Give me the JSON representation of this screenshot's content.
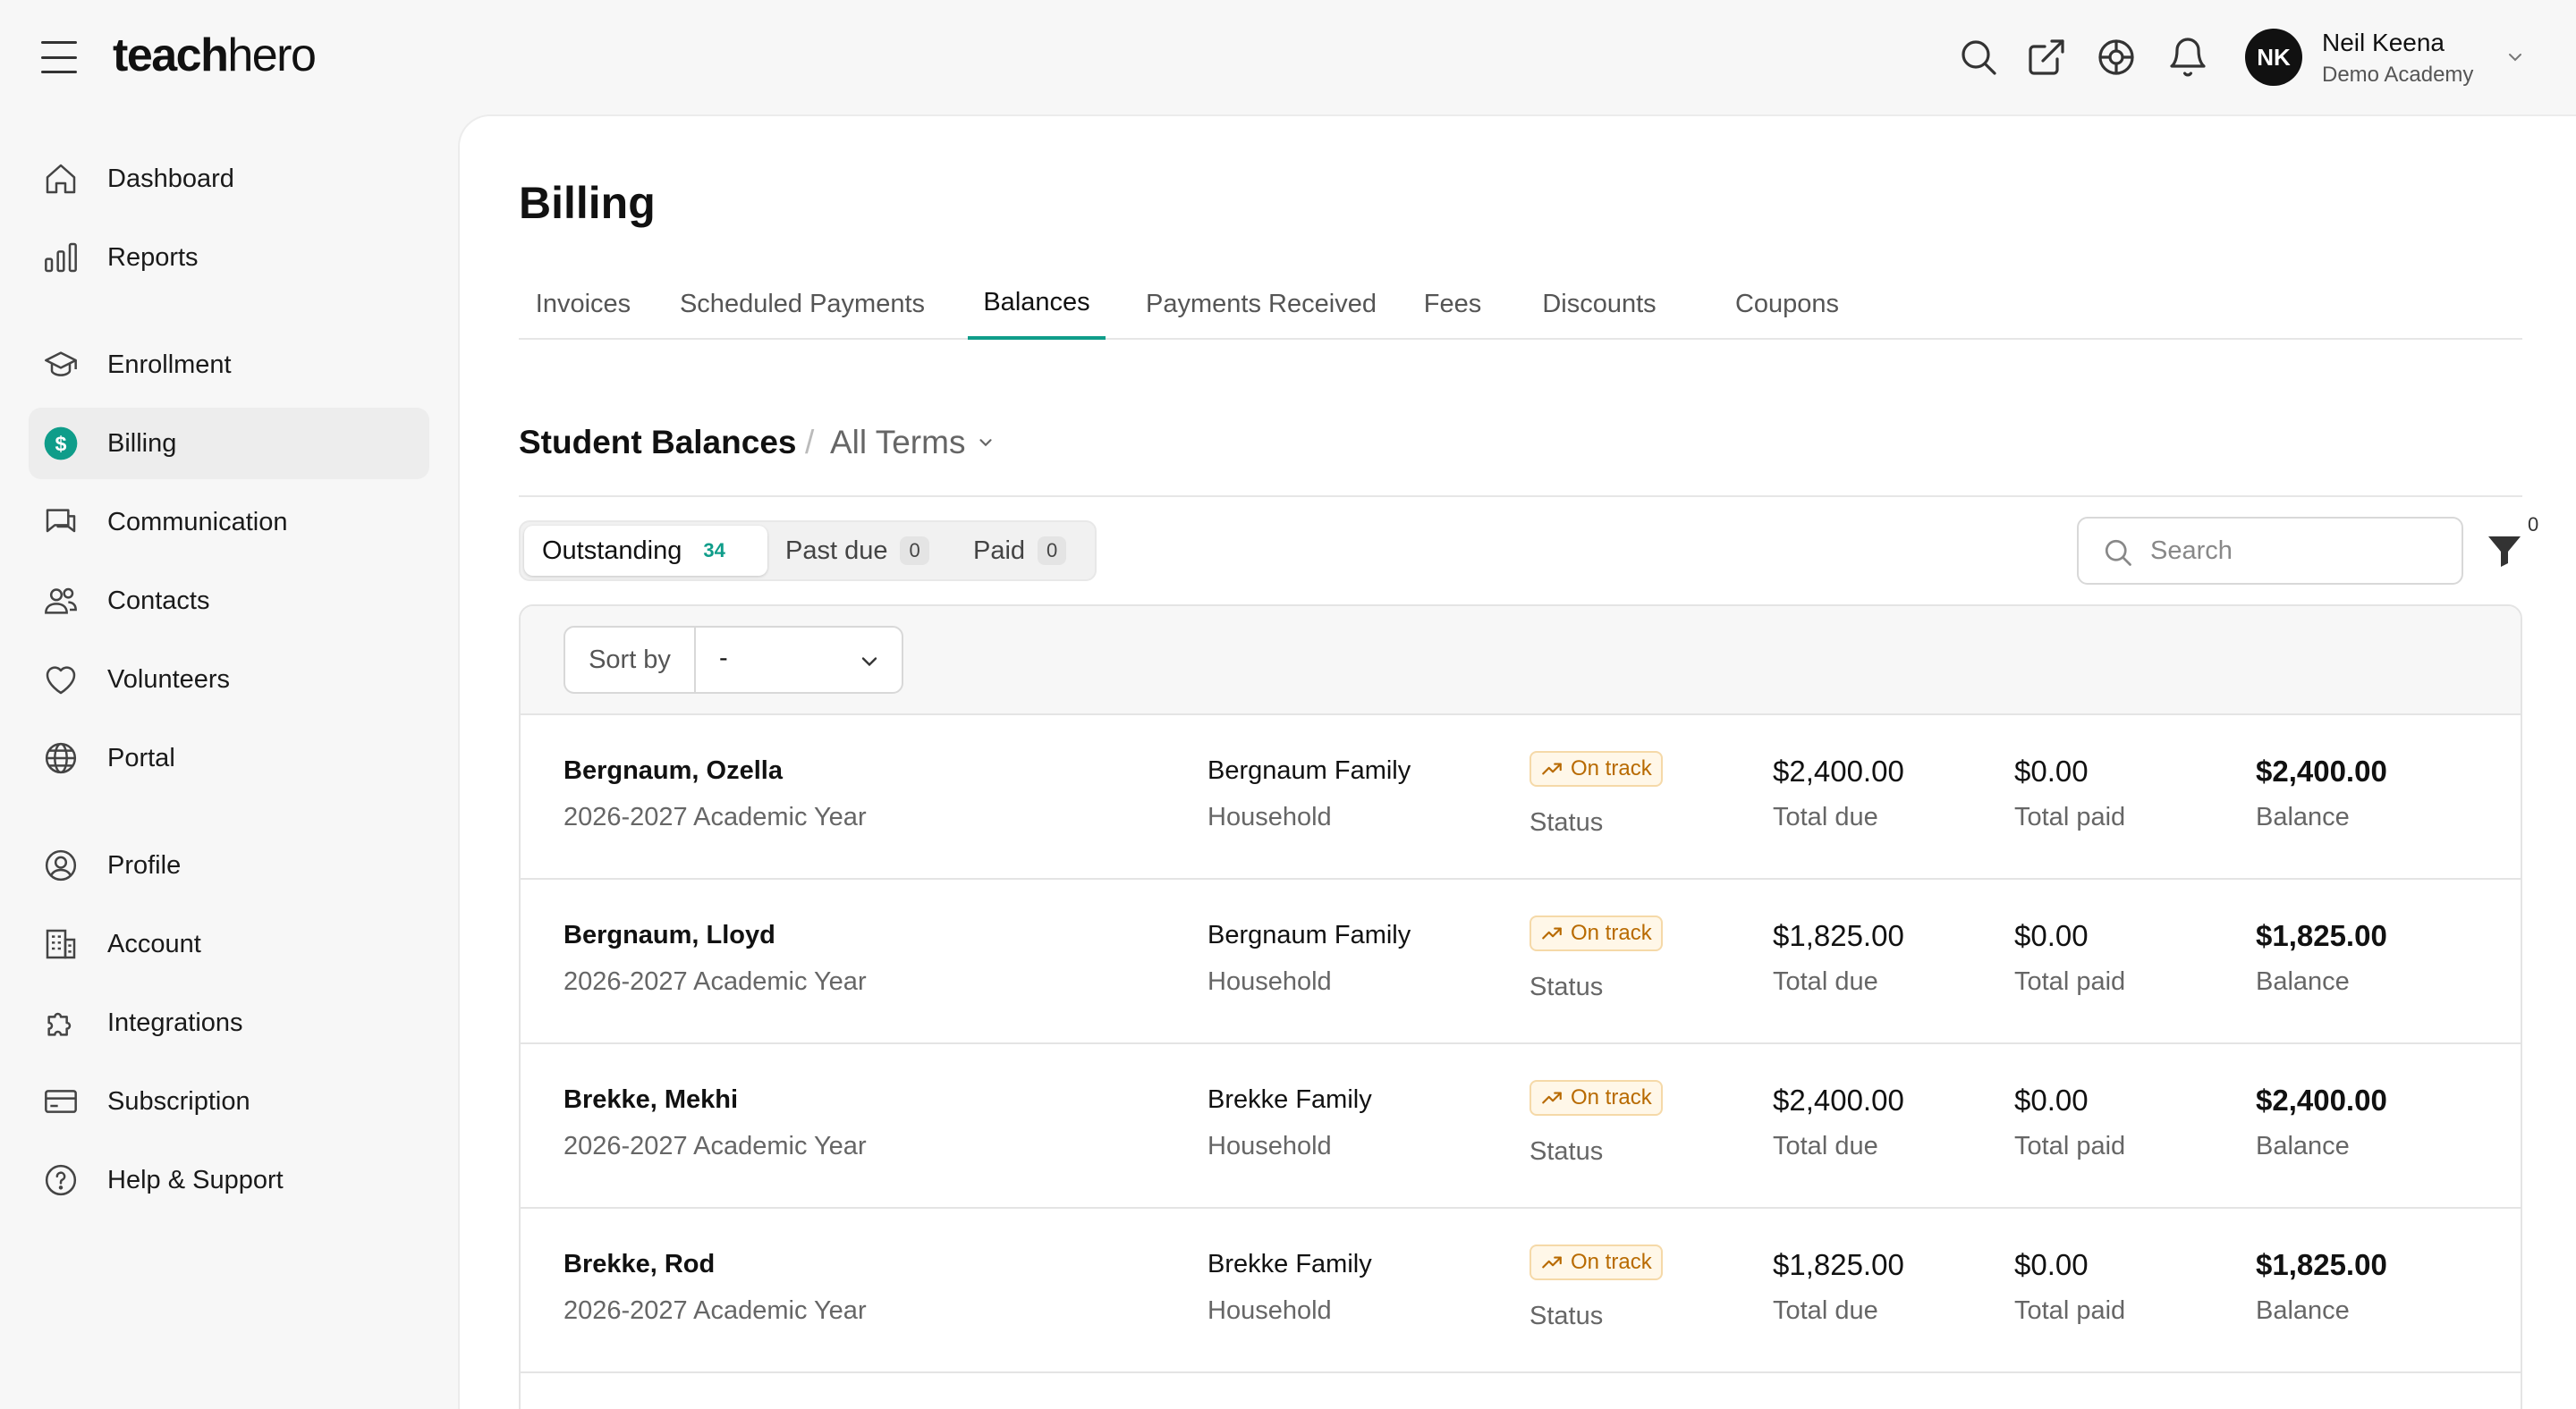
{
  "app": {
    "logo_bold": "teach",
    "logo_light": "hero"
  },
  "header": {
    "icons": [
      "search-icon",
      "external-link-icon",
      "support-icon",
      "bell-icon"
    ],
    "user": {
      "initials": "NK",
      "name": "Neil Keena",
      "org": "Demo Academy"
    }
  },
  "sidebar": {
    "items": [
      {
        "label": "Dashboard",
        "icon": "home-icon"
      },
      {
        "label": "Reports",
        "icon": "bar-chart-icon"
      },
      {
        "label": "Enrollment",
        "icon": "graduation-cap-icon"
      },
      {
        "label": "Billing",
        "icon": "dollar-icon",
        "active": true
      },
      {
        "label": "Communication",
        "icon": "chat-icon"
      },
      {
        "label": "Contacts",
        "icon": "users-icon"
      },
      {
        "label": "Volunteers",
        "icon": "heart-icon"
      },
      {
        "label": "Portal",
        "icon": "globe-icon"
      },
      {
        "label": "Profile",
        "icon": "user-circle-icon"
      },
      {
        "label": "Account",
        "icon": "building-icon"
      },
      {
        "label": "Integrations",
        "icon": "puzzle-icon"
      },
      {
        "label": "Subscription",
        "icon": "credit-card-icon"
      },
      {
        "label": "Help & Support",
        "icon": "help-icon"
      }
    ]
  },
  "page": {
    "title": "Billing",
    "tabs": [
      {
        "label": "Invoices"
      },
      {
        "label": "Scheduled Payments"
      },
      {
        "label": "Balances",
        "active": true
      },
      {
        "label": "Payments Received"
      },
      {
        "label": "Fees"
      },
      {
        "label": "Discounts"
      },
      {
        "label": "Coupons"
      }
    ],
    "section_title": "Student Balances",
    "section_separator": "/",
    "terms_filter": "All Terms"
  },
  "filters": {
    "segments": [
      {
        "label": "Outstanding",
        "count": "34",
        "active": true
      },
      {
        "label": "Past due",
        "count": "0"
      },
      {
        "label": "Paid",
        "count": "0"
      }
    ],
    "search_placeholder": "Search",
    "search_value": "",
    "active_filter_count": "0"
  },
  "table": {
    "sort_label": "Sort by",
    "sort_value": "-",
    "rows": [
      {
        "student": "Bergnaum, Ozella",
        "term": "2026-2027 Academic Year",
        "household": "Bergnaum Family",
        "household_label": "Household",
        "status": "On track",
        "status_label": "Status",
        "total_due": "$2,400.00",
        "total_due_label": "Total due",
        "total_paid": "$0.00",
        "total_paid_label": "Total paid",
        "balance": "$2,400.00",
        "balance_label": "Balance"
      },
      {
        "student": "Bergnaum, Lloyd",
        "term": "2026-2027 Academic Year",
        "household": "Bergnaum Family",
        "household_label": "Household",
        "status": "On track",
        "status_label": "Status",
        "total_due": "$1,825.00",
        "total_due_label": "Total due",
        "total_paid": "$0.00",
        "total_paid_label": "Total paid",
        "balance": "$1,825.00",
        "balance_label": "Balance"
      },
      {
        "student": "Brekke, Mekhi",
        "term": "2026-2027 Academic Year",
        "household": "Brekke Family",
        "household_label": "Household",
        "status": "On track",
        "status_label": "Status",
        "total_due": "$2,400.00",
        "total_due_label": "Total due",
        "total_paid": "$0.00",
        "total_paid_label": "Total paid",
        "balance": "$2,400.00",
        "balance_label": "Balance"
      },
      {
        "student": "Brekke, Rod",
        "term": "2026-2027 Academic Year",
        "household": "Brekke Family",
        "household_label": "Household",
        "status": "On track",
        "status_label": "Status",
        "total_due": "$1,825.00",
        "total_due_label": "Total due",
        "total_paid": "$0.00",
        "total_paid_label": "Total paid",
        "balance": "$1,825.00",
        "balance_label": "Balance"
      }
    ]
  },
  "colors": {
    "accent": "#0f9d8a",
    "status_on_track": "#b86a00"
  }
}
